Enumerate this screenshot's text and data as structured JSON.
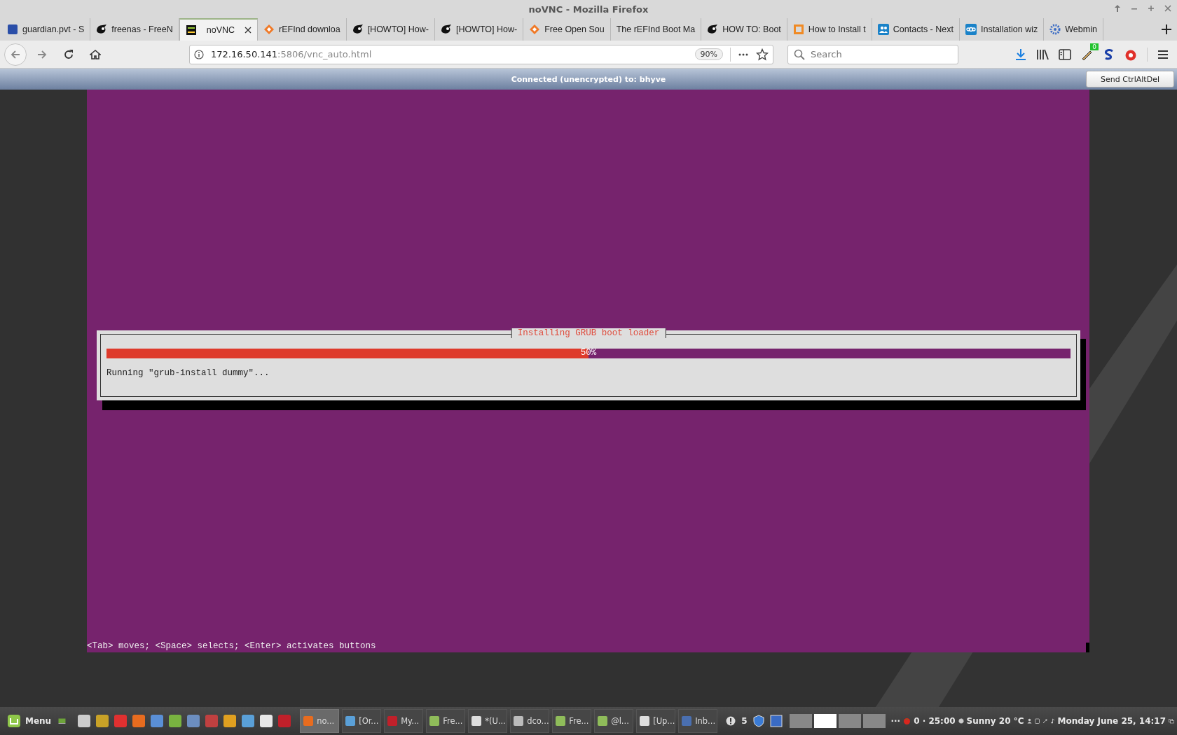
{
  "window": {
    "title": "noVNC - Mozilla Firefox"
  },
  "tabs": [
    {
      "label": "guardian.pvt - S",
      "selected": false
    },
    {
      "label": "freenas - FreeN",
      "selected": false
    },
    {
      "label": "noVNC",
      "selected": true
    },
    {
      "label": "rEFInd downloa",
      "selected": false
    },
    {
      "label": "[HOWTO] How-",
      "selected": false
    },
    {
      "label": "[HOWTO] How-",
      "selected": false
    },
    {
      "label": "Free Open Sou",
      "selected": false
    },
    {
      "label": "The rEFInd Boot Ma",
      "selected": false
    },
    {
      "label": "HOW TO: Boot",
      "selected": false
    },
    {
      "label": "How to Install t",
      "selected": false
    },
    {
      "label": "Contacts - Next",
      "selected": false
    },
    {
      "label": "Installation wiz",
      "selected": false
    },
    {
      "label": "Webmin",
      "selected": false
    }
  ],
  "toolbar": {
    "url_host": "172.16.50.141",
    "url_path": ":5806/vnc_auto.html",
    "zoom": "90%",
    "search": {
      "placeholder": "Search"
    },
    "extension_badge": "0"
  },
  "novnc": {
    "status": "Connected (unencrypted) to: bhyve",
    "button": "Send CtrlAltDel"
  },
  "installer": {
    "dialog_title": "Installing GRUB boot loader",
    "progress": {
      "level": 0.5,
      "label": "50%"
    },
    "message": "Running \"grub-install dummy\"...",
    "help": "<Tab> moves; <Space> selects; <Enter> activates buttons"
  },
  "taskbar": {
    "menu": "Menu",
    "windows": [
      {
        "label": "no...",
        "selected": true
      },
      {
        "label": "[Or...",
        "selected": false
      },
      {
        "label": "My...",
        "selected": false
      },
      {
        "label": "Fre...",
        "selected": false
      },
      {
        "label": "*(U...",
        "selected": false
      },
      {
        "label": "dco...",
        "selected": false
      },
      {
        "label": "Fre...",
        "selected": false
      },
      {
        "label": "@l...",
        "selected": false
      },
      {
        "label": "[Up...",
        "selected": false
      },
      {
        "label": "Inb...",
        "selected": false
      }
    ],
    "notifications": "5",
    "workspaces": [
      {
        "selected": false
      },
      {
        "selected": true
      },
      {
        "selected": false
      },
      {
        "selected": false
      }
    ],
    "overflow": "···",
    "timer": "0 · 25:00",
    "weather": "Sunny 20 °C",
    "clock": "Monday June 25, 14:17"
  }
}
